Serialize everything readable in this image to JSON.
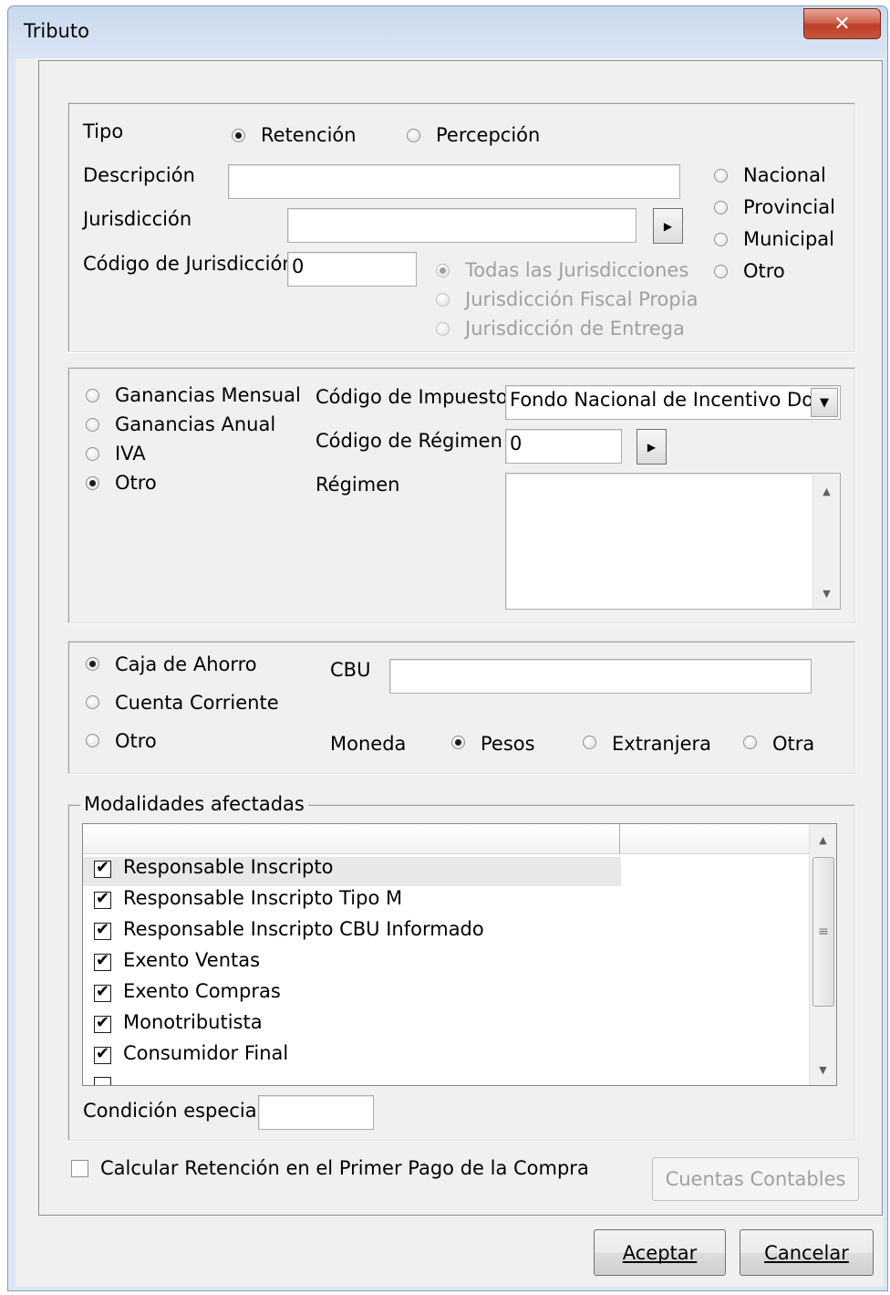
{
  "window": {
    "title": "Tributo"
  },
  "section1": {
    "tipo_label": "Tipo",
    "retencion_label": "Retención",
    "percepcion_label": "Percepción",
    "descripcion_label": "Descripción",
    "descripcion_value": "",
    "jurisdiccion_label": "Jurisdicción",
    "jurisdiccion_value": "",
    "codigo_label": "Código de Jurisdicción",
    "codigo_value": "0",
    "juris_options": [
      "Todas las Jurisdicciones",
      "Jurisdicción Fiscal Propia",
      "Jurisdicción de Entrega"
    ],
    "scope_options": [
      "Nacional",
      "Provincial",
      "Municipal",
      "Otro"
    ]
  },
  "section2": {
    "tipo_options": [
      "Ganancias Mensual",
      "Ganancias Anual",
      "IVA",
      "Otro"
    ],
    "codigo_impuesto_label": "Código de Impuesto",
    "codigo_impuesto_value": "Fondo Nacional de Incentivo Doc",
    "codigo_regimen_label": "Código de Régimen",
    "codigo_regimen_value": "0",
    "regimen_label": "Régimen",
    "regimen_value": ""
  },
  "section3": {
    "cuenta_options": [
      "Caja de Ahorro",
      "Cuenta Corriente",
      "Otro"
    ],
    "cbu_label": "CBU",
    "cbu_value": "",
    "moneda_label": "Moneda",
    "moneda_options": [
      "Pesos",
      "Extranjera",
      "Otra"
    ]
  },
  "modalidades": {
    "legend": "Modalidades afectadas",
    "items": [
      {
        "label": "Responsable Inscripto",
        "checked": true
      },
      {
        "label": "Responsable Inscripto Tipo M",
        "checked": true
      },
      {
        "label": "Responsable Inscripto CBU Informado",
        "checked": true
      },
      {
        "label": "Exento Ventas",
        "checked": true
      },
      {
        "label": "Exento Compras",
        "checked": true
      },
      {
        "label": "Monotributista",
        "checked": true
      },
      {
        "label": "Consumidor Final",
        "checked": true
      }
    ],
    "condicion_label": "Condición especial",
    "condicion_value": ""
  },
  "bottom": {
    "calcular_label": "Calcular Retención en el Primer Pago de la Compra",
    "cuentas_button": "Cuentas Contables",
    "aceptar_button": "Aceptar",
    "cancelar_button": "Cancelar"
  }
}
